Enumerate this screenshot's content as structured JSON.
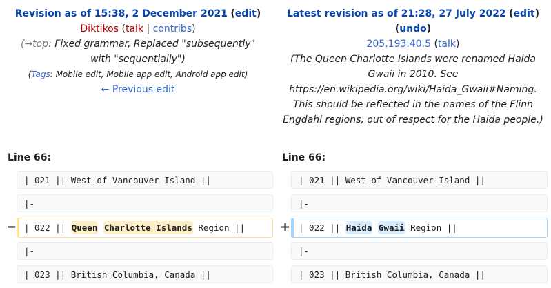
{
  "left": {
    "title": "Revision as of 15:38, 2 December 2021",
    "edit": "edit",
    "user": "Diktikos",
    "talk": "talk",
    "contribs": "contribs",
    "section": "→top:",
    "summary": "Fixed grammar, Replaced \"subsequently\" with \"sequentially\")",
    "tags_label": "Tags",
    "tags": ": Mobile edit, Mobile app edit, Android app edit)",
    "prev": "← Previous edit",
    "line": "Line 66:"
  },
  "right": {
    "title": "Latest revision as of 21:28, 27 July 2022",
    "edit": "edit",
    "undo": "undo",
    "user": "205.193.40.5",
    "talk": "talk",
    "summary": "(The Queen Charlotte Islands were renamed Haida Gwaii in 2010. See https://en.wikipedia.org/wiki/Haida_Gwaii#Naming. This should be reflected in the names of the Flinn Engdahl regions, out of respect for the Haida people.)",
    "line": "Line 66:"
  },
  "rows": {
    "r1": "| 021 || West of Vancouver Island ||",
    "r2": "|-",
    "pre": "| 022 || ",
    "del1": "Queen",
    "del2": "Charlotte Islands",
    "add1": "Haida",
    "add2": "Gwaii",
    "post": " Region ||",
    "r4": "|-",
    "r5": "| 023 || British Columbia, Canada ||",
    "minus": "−",
    "plus": "+"
  }
}
